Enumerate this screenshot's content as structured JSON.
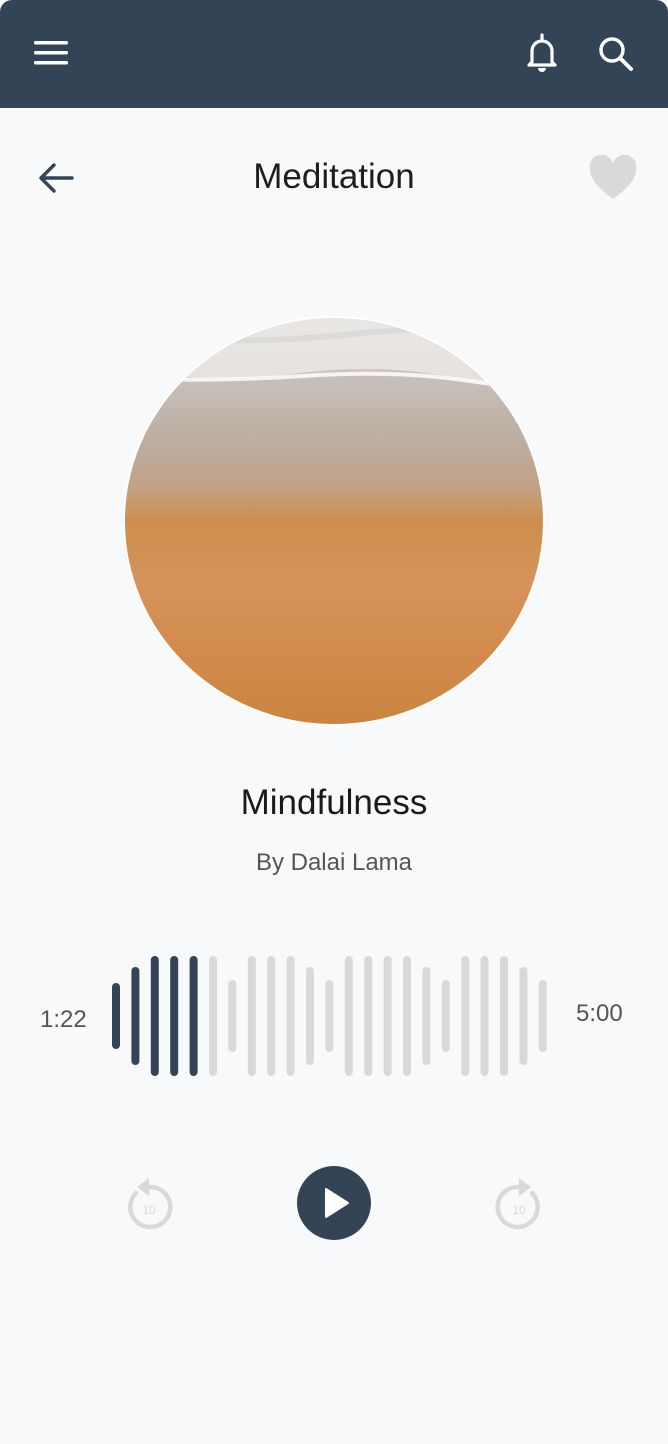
{
  "header": {
    "icons": [
      "menu-icon",
      "bell-icon",
      "search-icon"
    ],
    "background_color": "#344457"
  },
  "page": {
    "title": "Meditation",
    "icons": [
      "arrow-left-icon",
      "heart-icon"
    ]
  },
  "track": {
    "title": "Mindfulness",
    "author": "By Dalai Lama",
    "cover": "beach-sand-shoreline-image"
  },
  "player": {
    "elapsed": "1:22",
    "duration": "5:00",
    "progress_bars_played": 5,
    "waveform_levels": [
      0.55,
      0.82,
      1.0,
      1.0,
      1.0,
      1.0,
      0.6,
      1.0,
      1.0,
      1.0,
      0.82,
      0.6,
      1.0,
      1.0,
      1.0,
      1.0,
      0.82,
      0.6,
      1.0,
      1.0,
      1.0,
      0.82,
      0.6
    ],
    "skip_back_label": "10",
    "skip_forward_label": "10",
    "colors": {
      "played": "#344457",
      "unplayed": "#d9d9d9",
      "accent": "#344457"
    }
  }
}
